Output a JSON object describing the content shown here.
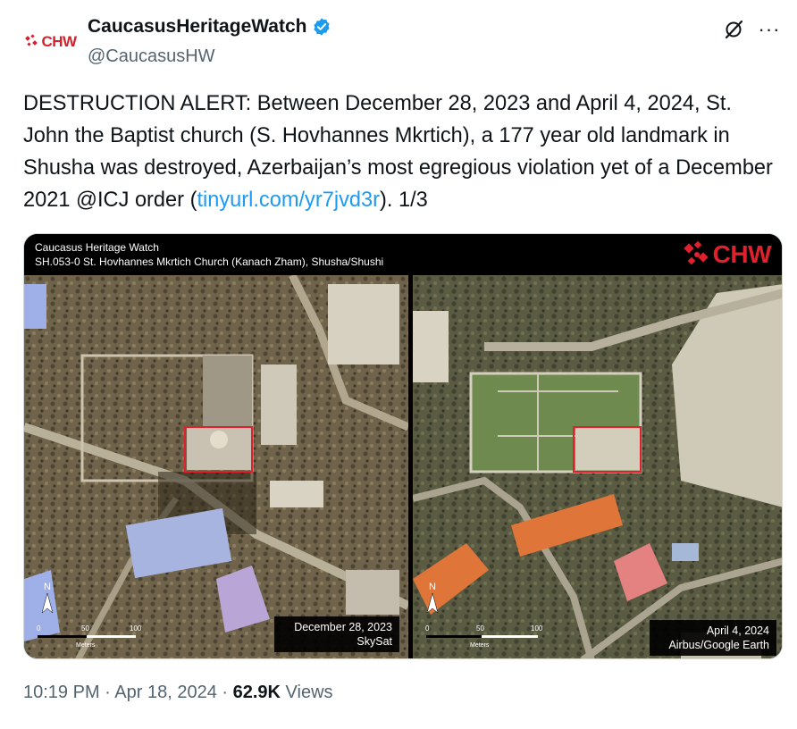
{
  "author": {
    "avatar_text": "CHW",
    "display_name": "CaucasusHeritageWatch",
    "handle": "@CaucasusHW",
    "verified": true,
    "verified_icon": "verified-badge-icon",
    "accent": "#1d9bf0"
  },
  "actions": {
    "grok_icon": "grok-icon",
    "more_label": "···"
  },
  "text": {
    "before_link": "DESTRUCTION ALERT: Between December 28, 2023 and April 4, 2024, St. John the Baptist church (S. Hovhannes Mkrtich), a 177 year old landmark in Shusha was destroyed, Azerbaijan’s most egregious violation yet of a December 2021 @ICJ order (",
    "link": "tinyurl.com/yr7jvd3r",
    "after_link": "). 1/3"
  },
  "media": {
    "title": "Caucasus Heritage Watch",
    "subtitle": "SH.053-0 St. Hovhannes Mkrtich Church (Kanach Zham), Shusha/Shushi",
    "logo_text": "CHW",
    "logo_color": "#e0202c",
    "left": {
      "date": "December 28, 2023",
      "source": "SkySat",
      "scale_labels": [
        "0",
        "50",
        "100"
      ],
      "scale_unit": "Meters",
      "north": "N"
    },
    "right": {
      "date": "April 4, 2024",
      "source": "Airbus/Google Earth",
      "scale_labels": [
        "0",
        "50",
        "100"
      ],
      "scale_unit": "Meters",
      "north": "N"
    }
  },
  "footer": {
    "time": "10:19 PM",
    "date": "Apr 18, 2024",
    "views_count": "62.9K",
    "views_label": "Views"
  }
}
